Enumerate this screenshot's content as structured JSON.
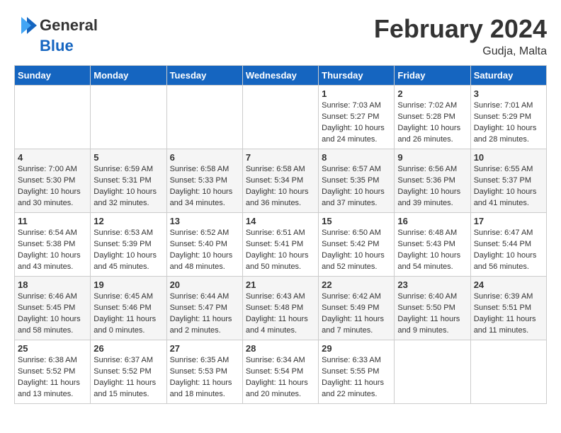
{
  "header": {
    "logo_general": "General",
    "logo_blue": "Blue",
    "month": "February 2024",
    "location": "Gudja, Malta"
  },
  "weekdays": [
    "Sunday",
    "Monday",
    "Tuesday",
    "Wednesday",
    "Thursday",
    "Friday",
    "Saturday"
  ],
  "weeks": [
    [
      {
        "day": "",
        "info": ""
      },
      {
        "day": "",
        "info": ""
      },
      {
        "day": "",
        "info": ""
      },
      {
        "day": "",
        "info": ""
      },
      {
        "day": "1",
        "info": "Sunrise: 7:03 AM\nSunset: 5:27 PM\nDaylight: 10 hours\nand 24 minutes."
      },
      {
        "day": "2",
        "info": "Sunrise: 7:02 AM\nSunset: 5:28 PM\nDaylight: 10 hours\nand 26 minutes."
      },
      {
        "day": "3",
        "info": "Sunrise: 7:01 AM\nSunset: 5:29 PM\nDaylight: 10 hours\nand 28 minutes."
      }
    ],
    [
      {
        "day": "4",
        "info": "Sunrise: 7:00 AM\nSunset: 5:30 PM\nDaylight: 10 hours\nand 30 minutes."
      },
      {
        "day": "5",
        "info": "Sunrise: 6:59 AM\nSunset: 5:31 PM\nDaylight: 10 hours\nand 32 minutes."
      },
      {
        "day": "6",
        "info": "Sunrise: 6:58 AM\nSunset: 5:33 PM\nDaylight: 10 hours\nand 34 minutes."
      },
      {
        "day": "7",
        "info": "Sunrise: 6:58 AM\nSunset: 5:34 PM\nDaylight: 10 hours\nand 36 minutes."
      },
      {
        "day": "8",
        "info": "Sunrise: 6:57 AM\nSunset: 5:35 PM\nDaylight: 10 hours\nand 37 minutes."
      },
      {
        "day": "9",
        "info": "Sunrise: 6:56 AM\nSunset: 5:36 PM\nDaylight: 10 hours\nand 39 minutes."
      },
      {
        "day": "10",
        "info": "Sunrise: 6:55 AM\nSunset: 5:37 PM\nDaylight: 10 hours\nand 41 minutes."
      }
    ],
    [
      {
        "day": "11",
        "info": "Sunrise: 6:54 AM\nSunset: 5:38 PM\nDaylight: 10 hours\nand 43 minutes."
      },
      {
        "day": "12",
        "info": "Sunrise: 6:53 AM\nSunset: 5:39 PM\nDaylight: 10 hours\nand 45 minutes."
      },
      {
        "day": "13",
        "info": "Sunrise: 6:52 AM\nSunset: 5:40 PM\nDaylight: 10 hours\nand 48 minutes."
      },
      {
        "day": "14",
        "info": "Sunrise: 6:51 AM\nSunset: 5:41 PM\nDaylight: 10 hours\nand 50 minutes."
      },
      {
        "day": "15",
        "info": "Sunrise: 6:50 AM\nSunset: 5:42 PM\nDaylight: 10 hours\nand 52 minutes."
      },
      {
        "day": "16",
        "info": "Sunrise: 6:48 AM\nSunset: 5:43 PM\nDaylight: 10 hours\nand 54 minutes."
      },
      {
        "day": "17",
        "info": "Sunrise: 6:47 AM\nSunset: 5:44 PM\nDaylight: 10 hours\nand 56 minutes."
      }
    ],
    [
      {
        "day": "18",
        "info": "Sunrise: 6:46 AM\nSunset: 5:45 PM\nDaylight: 10 hours\nand 58 minutes."
      },
      {
        "day": "19",
        "info": "Sunrise: 6:45 AM\nSunset: 5:46 PM\nDaylight: 11 hours\nand 0 minutes."
      },
      {
        "day": "20",
        "info": "Sunrise: 6:44 AM\nSunset: 5:47 PM\nDaylight: 11 hours\nand 2 minutes."
      },
      {
        "day": "21",
        "info": "Sunrise: 6:43 AM\nSunset: 5:48 PM\nDaylight: 11 hours\nand 4 minutes."
      },
      {
        "day": "22",
        "info": "Sunrise: 6:42 AM\nSunset: 5:49 PM\nDaylight: 11 hours\nand 7 minutes."
      },
      {
        "day": "23",
        "info": "Sunrise: 6:40 AM\nSunset: 5:50 PM\nDaylight: 11 hours\nand 9 minutes."
      },
      {
        "day": "24",
        "info": "Sunrise: 6:39 AM\nSunset: 5:51 PM\nDaylight: 11 hours\nand 11 minutes."
      }
    ],
    [
      {
        "day": "25",
        "info": "Sunrise: 6:38 AM\nSunset: 5:52 PM\nDaylight: 11 hours\nand 13 minutes."
      },
      {
        "day": "26",
        "info": "Sunrise: 6:37 AM\nSunset: 5:52 PM\nDaylight: 11 hours\nand 15 minutes."
      },
      {
        "day": "27",
        "info": "Sunrise: 6:35 AM\nSunset: 5:53 PM\nDaylight: 11 hours\nand 18 minutes."
      },
      {
        "day": "28",
        "info": "Sunrise: 6:34 AM\nSunset: 5:54 PM\nDaylight: 11 hours\nand 20 minutes."
      },
      {
        "day": "29",
        "info": "Sunrise: 6:33 AM\nSunset: 5:55 PM\nDaylight: 11 hours\nand 22 minutes."
      },
      {
        "day": "",
        "info": ""
      },
      {
        "day": "",
        "info": ""
      }
    ]
  ]
}
